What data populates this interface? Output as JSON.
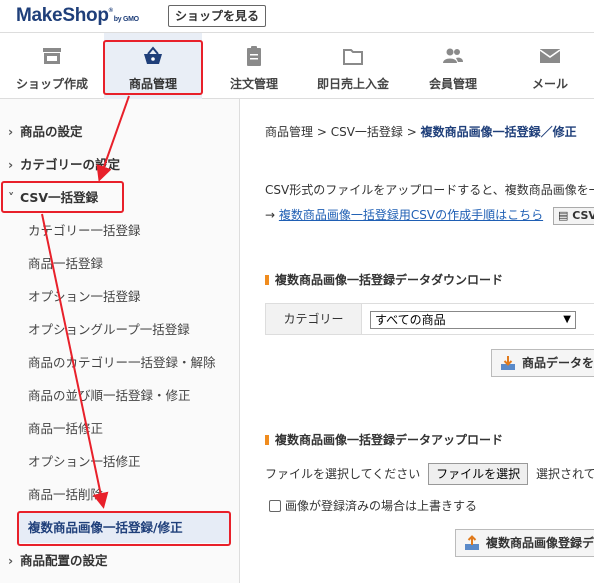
{
  "header": {
    "logo_main": "MakeShop",
    "logo_by": "by GMO",
    "shop_button": "ショップを見る"
  },
  "topnav": {
    "items": [
      {
        "label": "ショップ作成",
        "icon": "shop-icon"
      },
      {
        "label": "商品管理",
        "icon": "shopping-basket-icon",
        "active": true
      },
      {
        "label": "注文管理",
        "icon": "clipboard-icon"
      },
      {
        "label": "即日売上入金",
        "icon": "folder-icon"
      },
      {
        "label": "会員管理",
        "icon": "members-icon"
      },
      {
        "label": "メール",
        "icon": "mail-icon"
      }
    ]
  },
  "sidebar": {
    "items": [
      {
        "label": "商品の設定",
        "type": "top"
      },
      {
        "label": "カテゴリーの設定",
        "type": "top"
      },
      {
        "label": "CSV一括登録",
        "type": "top",
        "expanded": true
      },
      {
        "label": "カテゴリー一括登録",
        "type": "sub"
      },
      {
        "label": "商品一括登録",
        "type": "sub"
      },
      {
        "label": "オプション一括登録",
        "type": "sub"
      },
      {
        "label": "オプショングループ一括登録",
        "type": "sub"
      },
      {
        "label": "商品のカテゴリー一括登録・解除",
        "type": "sub"
      },
      {
        "label": "商品の並び順一括登録・修正",
        "type": "sub"
      },
      {
        "label": "商品一括修正",
        "type": "sub"
      },
      {
        "label": "オプション一括修正",
        "type": "sub"
      },
      {
        "label": "商品一括削除",
        "type": "sub"
      },
      {
        "label": "複数商品画像一括登録/修正",
        "type": "sub",
        "current": true
      },
      {
        "label": "商品配置の設定",
        "type": "top"
      }
    ]
  },
  "main": {
    "breadcrumb": {
      "part1": "商品管理",
      "sep": " > ",
      "part2": "CSV一括登録",
      "current": "複数商品画像一括登録／修正"
    },
    "description": "CSV形式のファイルをアップロードすると、複数商品画像を一括登録",
    "guide_arrow": "→",
    "guide_link": "複数商品画像一括登録用CSVの作成手順はこちら",
    "guide_button": "CSVサ",
    "download_section": {
      "title": "複数商品画像一括登録データダウンロード",
      "category_label": "カテゴリー",
      "category_value": "すべての商品",
      "button": "商品データをダ"
    },
    "upload_section": {
      "title": "複数商品画像一括登録データアップロード",
      "file_label": "ファイルを選択してください",
      "file_button": "ファイルを選択",
      "file_status": "選択されていませ",
      "overwrite_label": "画像が登録済みの場合は上書きする",
      "button": "複数商品画像登録デ"
    }
  },
  "colors": {
    "brand": "#1f3f7a",
    "accent": "#f08c1e",
    "annotation": "#e8202a",
    "link": "#1f5fb4"
  }
}
